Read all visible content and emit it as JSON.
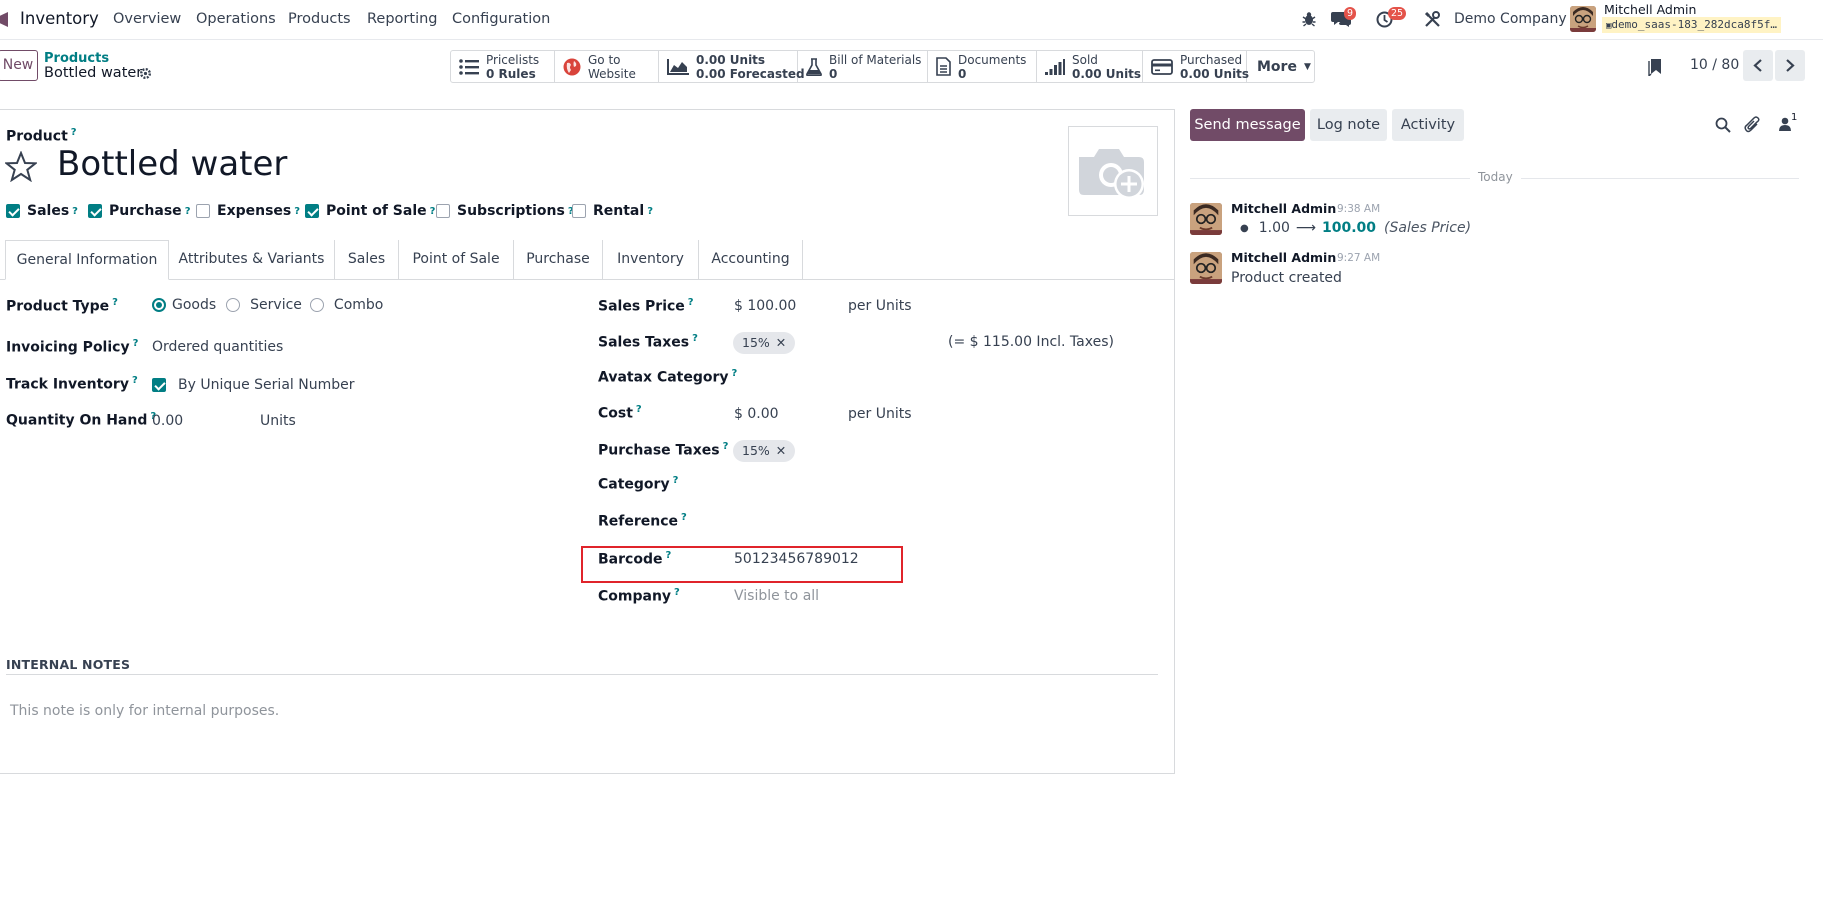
{
  "navbar": {
    "app_name": "Inventory",
    "menu": [
      "Overview",
      "Operations",
      "Products",
      "Reporting",
      "Configuration"
    ],
    "messages_badge": "9",
    "activities_badge": "25",
    "company": "Demo Company",
    "user_name": "Mitchell Admin",
    "user_db": "demo_saas-183_282dca8f5f…"
  },
  "control": {
    "new_label": "New",
    "breadcrumb_parent": "Products",
    "breadcrumb_current": "Bottled water",
    "pager": "10 / 80",
    "smart_buttons": [
      {
        "line1": "Pricelists",
        "line2": "0 Rules",
        "icon": "list-icon"
      },
      {
        "line1": "Go to",
        "line2": "Website",
        "icon": "globe-icon"
      },
      {
        "line1": "0.00 Units",
        "line2": "0.00 Forecasted",
        "icon": "chart-icon"
      },
      {
        "line1": "Bill of Materials",
        "line2": "0",
        "icon": "flask-icon"
      },
      {
        "line1": "Documents",
        "line2": "0",
        "icon": "document-icon"
      },
      {
        "line1": "Sold",
        "line2": "0.00 Units",
        "icon": "signal-icon"
      },
      {
        "line1": "Purchased",
        "line2": "0.00 Units",
        "icon": "credit-card-icon"
      }
    ],
    "more_label": "More"
  },
  "form": {
    "product_label": "Product",
    "product_name": "Bottled water",
    "checks": [
      {
        "label": "Sales",
        "checked": true
      },
      {
        "label": "Purchase",
        "checked": true
      },
      {
        "label": "Expenses",
        "checked": false
      },
      {
        "label": "Point of Sale",
        "checked": true
      },
      {
        "label": "Subscriptions",
        "checked": false
      },
      {
        "label": "Rental",
        "checked": false
      }
    ],
    "tabs": [
      "General Information",
      "Attributes & Variants",
      "Sales",
      "Point of Sale",
      "Purchase",
      "Inventory",
      "Accounting"
    ],
    "left": {
      "product_type_label": "Product Type",
      "product_type_options": [
        "Goods",
        "Service",
        "Combo"
      ],
      "invoicing_policy_label": "Invoicing Policy",
      "invoicing_policy_value": "Ordered quantities",
      "track_inventory_label": "Track Inventory",
      "track_inventory_value": "By Unique Serial Number",
      "qty_on_hand_label": "Quantity On Hand",
      "qty_on_hand_value": "0.00",
      "qty_on_hand_uom": "Units"
    },
    "right": {
      "sales_price_label": "Sales Price",
      "sales_price_value": "$ 100.00",
      "sales_price_uom": "per Units",
      "sales_taxes_label": "Sales Taxes",
      "sales_taxes_tag": "15%",
      "sales_taxes_incl": "(= $ 115.00 Incl. Taxes)",
      "avatax_label": "Avatax Category",
      "cost_label": "Cost",
      "cost_value": "$ 0.00",
      "cost_uom": "per Units",
      "purchase_taxes_label": "Purchase Taxes",
      "purchase_taxes_tag": "15%",
      "category_label": "Category",
      "reference_label": "Reference",
      "barcode_label": "Barcode",
      "barcode_value": "50123456789012",
      "company_label": "Company",
      "company_placeholder": "Visible to all"
    },
    "notes_title": "INTERNAL NOTES",
    "notes_placeholder": "This note is only for internal purposes."
  },
  "chatter": {
    "send_message": "Send message",
    "log_note": "Log note",
    "activity": "Activity",
    "followers_count": "1",
    "date_separator": "Today",
    "messages": [
      {
        "author": "Mitchell Admin",
        "time": "9:38 AM",
        "old": "1.00",
        "new": "100.00",
        "field": "(Sales Price)"
      },
      {
        "author": "Mitchell Admin",
        "time": "9:27 AM",
        "body": "Product created"
      }
    ]
  },
  "colors": {
    "primary": "#714b67",
    "accent": "#017e84",
    "highlight_box": "#e0242b",
    "badge": "#e4534a"
  }
}
